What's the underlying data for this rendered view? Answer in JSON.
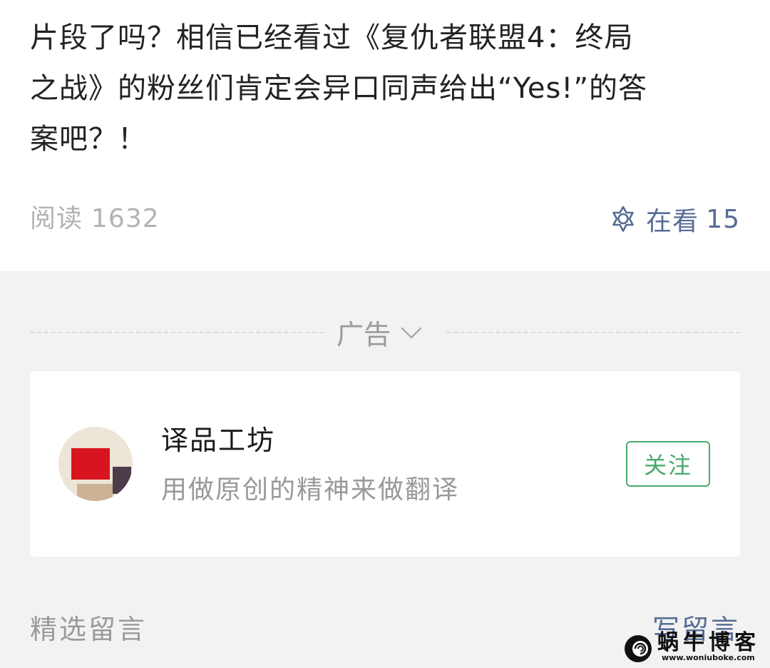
{
  "article": {
    "lines": [
      "片段了吗？相信已经看过《复仇者联盟4：终局",
      "之战》的粉丝们肯定会异口同声给出“Yes!”的答",
      "案吧？！"
    ]
  },
  "meta": {
    "read_label": "阅读",
    "read_count": "1632",
    "looking_label": "在看",
    "looking_count": "15",
    "looking_icon": "looking-star-icon",
    "link_color": "#576b95"
  },
  "ad": {
    "label": "广告",
    "toggle_icon": "chevron-down-icon"
  },
  "account": {
    "name": "译品工坊",
    "description": "用做原创的精神来做翻译",
    "follow_label": "关注",
    "follow_color": "#4aa96c"
  },
  "comments": {
    "title": "精选留言",
    "write_label": "写留言"
  },
  "watermark": {
    "text": "蜗牛博客",
    "url": "www.woniuboke.com"
  }
}
